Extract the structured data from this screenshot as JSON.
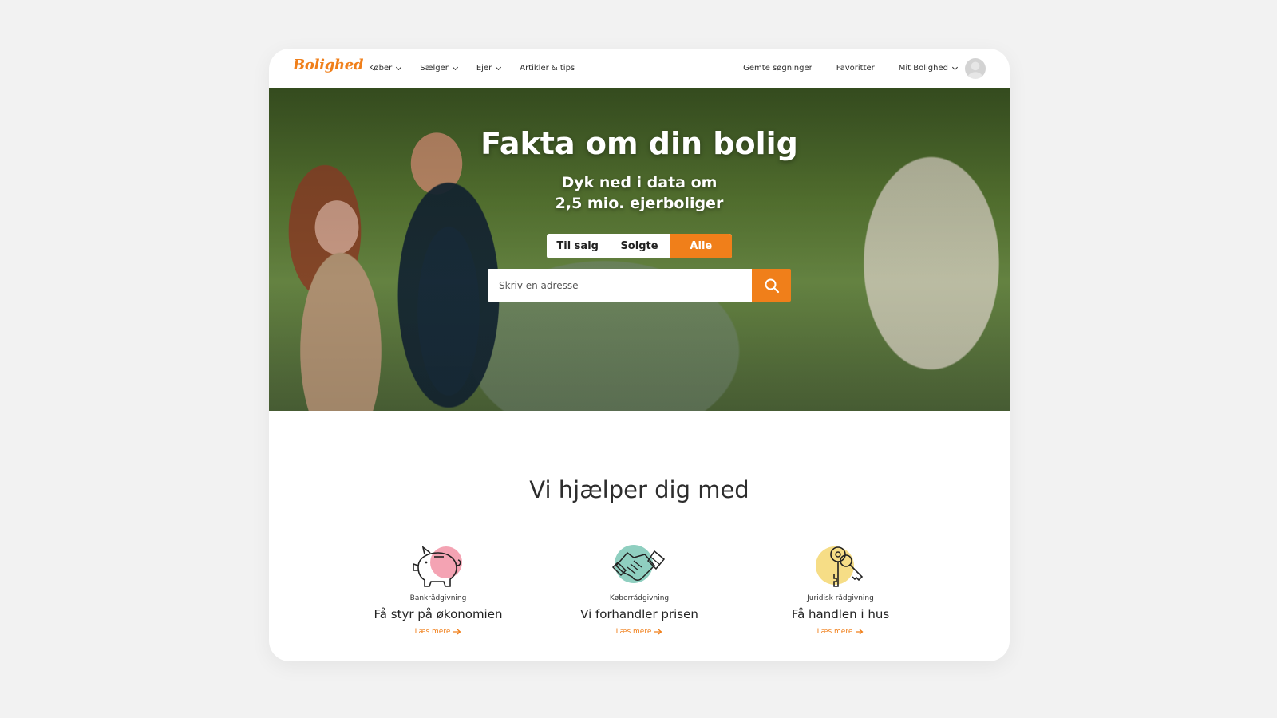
{
  "nav": {
    "logo": "Bolighed",
    "left_items": [
      "Køber",
      "Sælger",
      "Ejer",
      "Artikler & tips"
    ],
    "right_items": [
      "Gemte søgninger",
      "Favoritter",
      "Mit Bolighed"
    ]
  },
  "hero": {
    "title": "Fakta om din bolig",
    "subtitle_line1": "Dyk ned i data om",
    "subtitle_line2": "2,5 mio. ejerboliger",
    "tabs": [
      "Til salg",
      "Solgte",
      "Alle"
    ],
    "active_tab": "Alle",
    "search_placeholder": "Skriv en adresse"
  },
  "help": {
    "title": "Vi hjælper dig med",
    "cards": [
      {
        "category": "Bankrådgivning",
        "headline": "Få styr på økonomien",
        "link": "Læs mere",
        "icon": "piggy-bank-icon",
        "accent": "#f4a3b3"
      },
      {
        "category": "Køberrådgivning",
        "headline": "Vi forhandler prisen",
        "link": "Læs mere",
        "icon": "handshake-icon",
        "accent": "#8fcfc0"
      },
      {
        "category": "Juridisk rådgivning",
        "headline": "Få handlen i hus",
        "link": "Læs mere",
        "icon": "keys-icon",
        "accent": "#f6dd86"
      }
    ]
  },
  "colors": {
    "brand": "#f07f1a",
    "background": "#f2f2f2"
  }
}
